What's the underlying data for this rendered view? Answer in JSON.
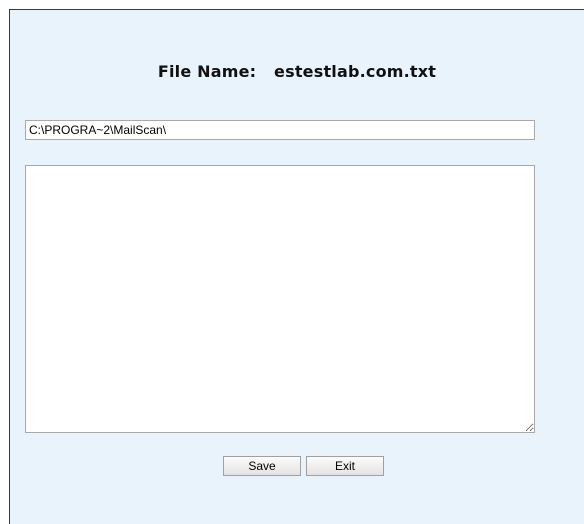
{
  "header": {
    "file_name_label": "File Name:",
    "file_name_value": "estestlab.com.txt"
  },
  "path_input": {
    "value": "C:\\PROGRA~2\\MailScan\\"
  },
  "content": {
    "value": ""
  },
  "buttons": {
    "save_label": "Save",
    "exit_label": "Exit"
  }
}
